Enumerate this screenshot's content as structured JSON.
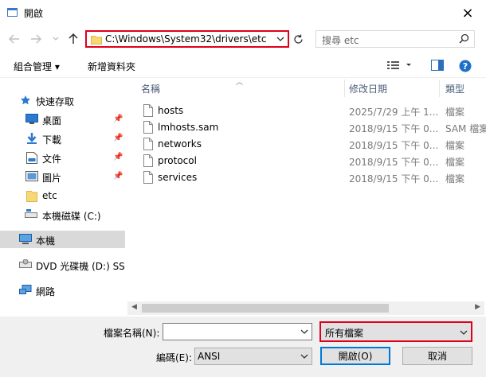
{
  "window": {
    "title": "開啟",
    "close_icon": "×"
  },
  "nav": {
    "address_path": "C:\\Windows\\System32\\drivers\\etc",
    "search_placeholder": "搜尋 etc"
  },
  "toolbar": {
    "organize_label": "組合管理 ▾",
    "new_folder_label": "新增資料夾"
  },
  "sidebar": {
    "items": [
      {
        "label": "快速存取",
        "icon": "star-icon"
      },
      {
        "label": "桌面",
        "icon": "desktop-icon",
        "pinned": true
      },
      {
        "label": "下載",
        "icon": "download-icon",
        "pinned": true
      },
      {
        "label": "文件",
        "icon": "document-icon",
        "pinned": true
      },
      {
        "label": "圖片",
        "icon": "picture-icon",
        "pinned": true
      },
      {
        "label": "etc",
        "icon": "folder-icon"
      },
      {
        "label": "本機磁碟 (C:)",
        "icon": "drive-icon"
      },
      {
        "label": "本機",
        "icon": "computer-icon",
        "selected": true
      },
      {
        "label": "DVD 光碟機 (D:) SSS",
        "icon": "dvd-icon"
      },
      {
        "label": "網路",
        "icon": "network-icon"
      }
    ]
  },
  "columns": {
    "name": "名稱",
    "date": "修改日期",
    "type": "類型"
  },
  "files": [
    {
      "name": "hosts",
      "date": "2025/7/29 上午 1...",
      "type": "檔案"
    },
    {
      "name": "lmhosts.sam",
      "date": "2018/9/15 下午 0...",
      "type": "SAM 檔案"
    },
    {
      "name": "networks",
      "date": "2018/9/15 下午 0...",
      "type": "檔案"
    },
    {
      "name": "protocol",
      "date": "2018/9/15 下午 0...",
      "type": "檔案"
    },
    {
      "name": "services",
      "date": "2018/9/15 下午 0...",
      "type": "檔案"
    }
  ],
  "bottom": {
    "filename_label": "檔案名稱(N):",
    "filename_value": "",
    "filetype_value": "所有檔案",
    "encoding_label": "編碼(E):",
    "encoding_value": "ANSI",
    "open_button": "開啟(O)",
    "cancel_button": "取消"
  },
  "colors": {
    "highlight_border": "#e0001b",
    "primary_button_border": "#0078d7",
    "selected_nav": "#d9d9d9"
  }
}
